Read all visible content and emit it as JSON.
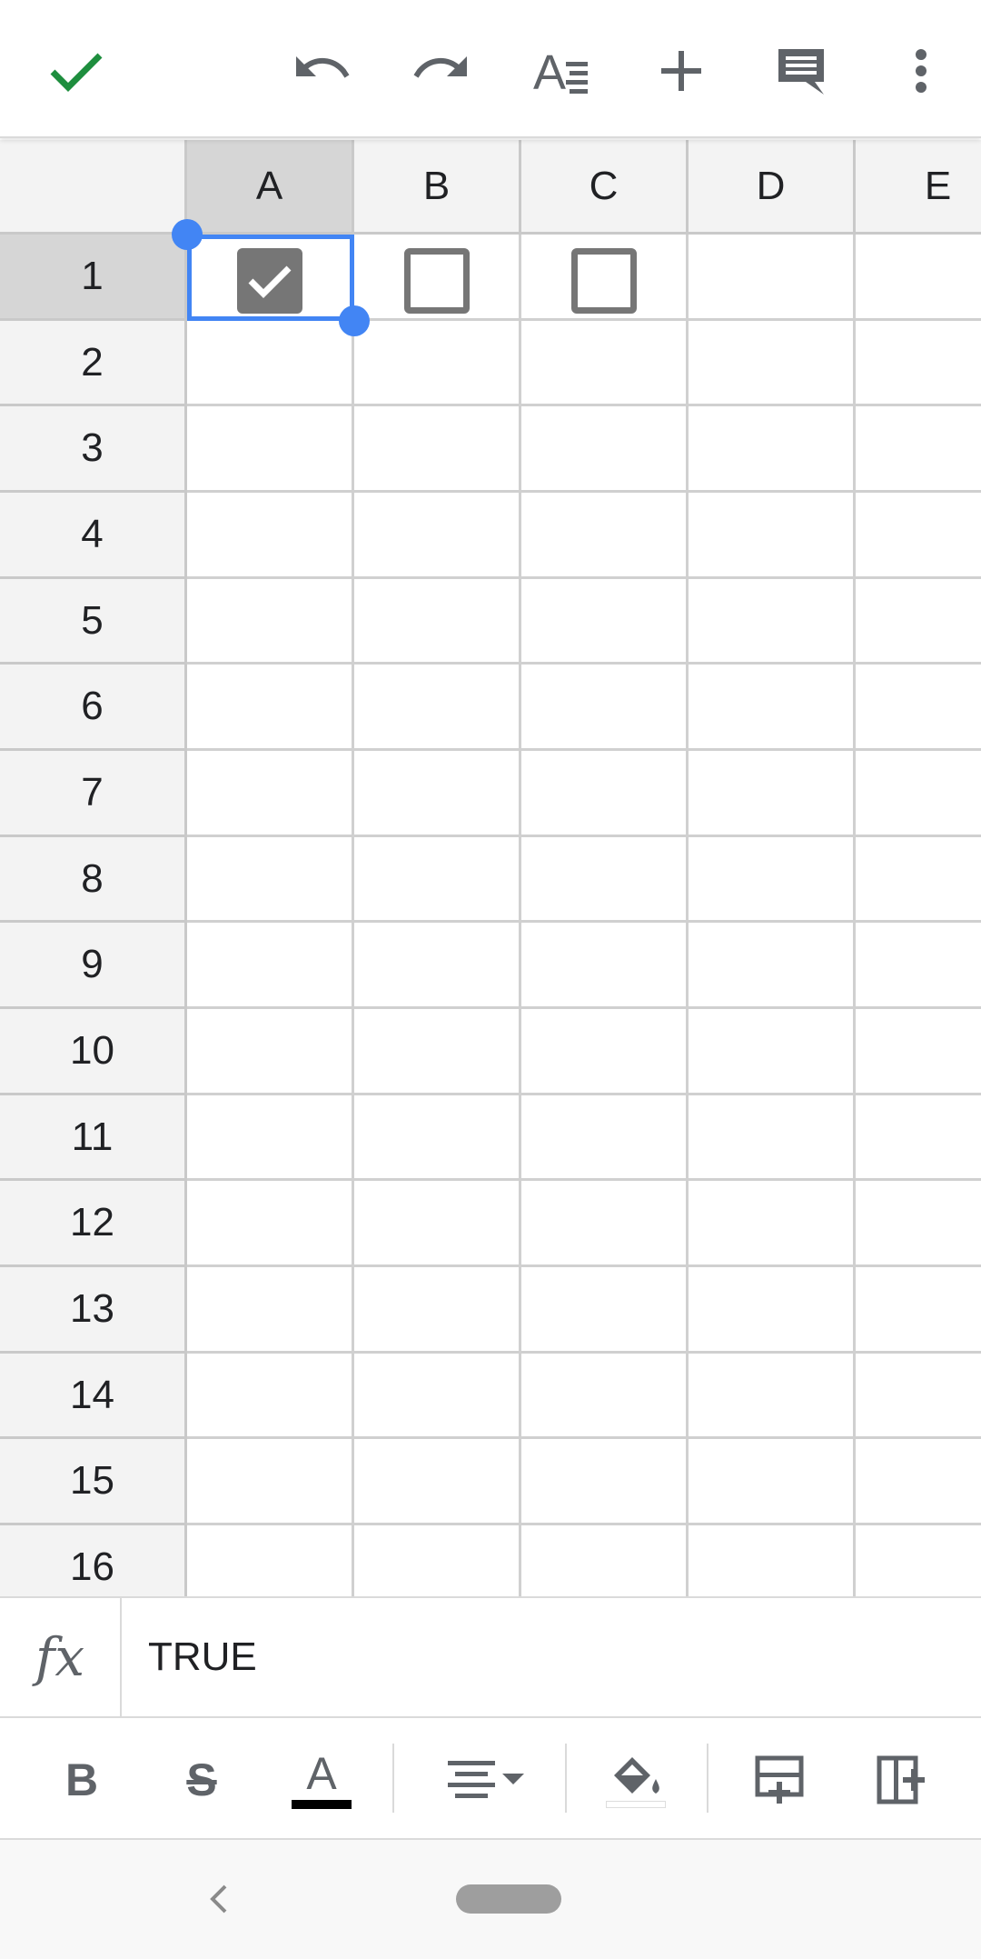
{
  "toolbar": {
    "done_icon": "check-icon",
    "undo_icon": "undo-icon",
    "redo_icon": "redo-icon",
    "format_icon": "text-format-icon",
    "insert_icon": "plus-icon",
    "comment_icon": "comment-icon",
    "more_icon": "more-vert-icon",
    "accent_color": "#1e8e3e"
  },
  "grid": {
    "columns": [
      "A",
      "B",
      "C",
      "D",
      "E"
    ],
    "rows": [
      "1",
      "2",
      "3",
      "4",
      "5",
      "6",
      "7",
      "8",
      "9",
      "10",
      "11",
      "12",
      "13",
      "14",
      "15",
      "16"
    ],
    "selected_cell": "A1",
    "cells": {
      "A1": {
        "type": "checkbox",
        "checked": true
      },
      "B1": {
        "type": "checkbox",
        "checked": false
      },
      "C1": {
        "type": "checkbox",
        "checked": false
      }
    },
    "selection_color": "#4285f4"
  },
  "formula_bar": {
    "label": "fx",
    "value": "TRUE"
  },
  "format_bar": {
    "bold": "B",
    "strikethrough": "S",
    "text_color": "A",
    "text_color_value": "#000000",
    "items": [
      "bold-icon",
      "strikethrough-icon",
      "text-color-icon",
      "align-icon",
      "fill-color-icon",
      "insert-row-icon",
      "insert-column-icon"
    ]
  },
  "navbar": {
    "back_icon": "chevron-left-icon",
    "home_icon": "home-pill-icon"
  }
}
